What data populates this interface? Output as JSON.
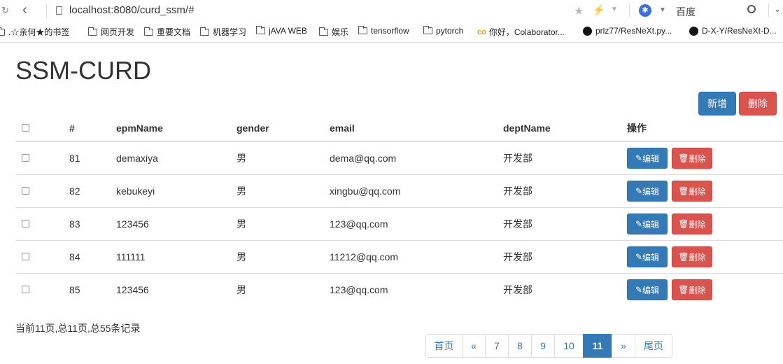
{
  "browser": {
    "url": "localhost:8080/curd_ssm/#",
    "search_engine": "百度",
    "bookmarks": [
      {
        "label": ".☆亲何★的书签",
        "icon": "folder-icon"
      },
      {
        "label": "网页开发",
        "icon": "folder-icon"
      },
      {
        "label": "重要文档",
        "icon": "folder-icon"
      },
      {
        "label": "机器学习",
        "icon": "folder-icon"
      },
      {
        "label": "jAVA WEB",
        "icon": "folder-icon"
      },
      {
        "label": "娱乐",
        "icon": "folder-icon"
      },
      {
        "label": "tensorflow",
        "icon": "folder-icon"
      },
      {
        "label": "pytorch",
        "icon": "folder-icon"
      },
      {
        "label": "你好，Colaborator...",
        "icon": "colab-icon"
      },
      {
        "label": "prlz77/ResNeXt.py...",
        "icon": "github-icon"
      },
      {
        "label": "D-X-Y/ResNeXt-D...",
        "icon": "github-icon"
      }
    ]
  },
  "page": {
    "title": "SSM-CURD",
    "add_label": "新增",
    "delete_label": "删除"
  },
  "table": {
    "headers": [
      "#",
      "epmName",
      "gender",
      "email",
      "deptName",
      "操作"
    ],
    "edit_label": "编辑",
    "row_delete_label": "删除",
    "rows": [
      {
        "id": "81",
        "name": "demaxiya",
        "gender": "男",
        "email": "dema@qq.com",
        "dept": "开发部"
      },
      {
        "id": "82",
        "name": "kebukeyi",
        "gender": "男",
        "email": "xingbu@qq.com",
        "dept": "开发部"
      },
      {
        "id": "83",
        "name": "123456",
        "gender": "男",
        "email": "123@qq.com",
        "dept": "开发部"
      },
      {
        "id": "84",
        "name": "111111",
        "gender": "男",
        "email": "11212@qq.com",
        "dept": "开发部"
      },
      {
        "id": "85",
        "name": "123456",
        "gender": "男",
        "email": "123@qq.com",
        "dept": "开发部"
      }
    ]
  },
  "pagination": {
    "info": "当前11页,总11页,总55条记录",
    "first": "首页",
    "prev": "«",
    "pages": [
      "7",
      "8",
      "9",
      "10",
      "11"
    ],
    "active_page": "11",
    "next": "»",
    "last": "尾页"
  },
  "colors": {
    "primary": "#337ab7",
    "danger": "#d9534f"
  }
}
